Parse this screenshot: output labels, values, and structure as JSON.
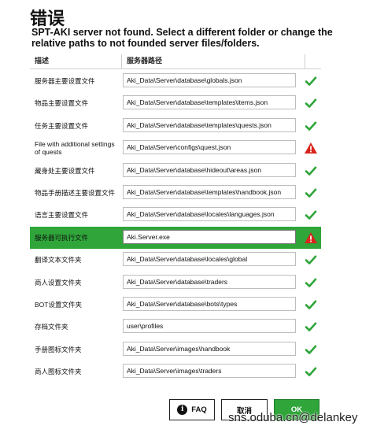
{
  "dialog": {
    "title": "错误",
    "message": "SPT-AKI server not found. Select a different folder or change the relative paths to not founded server files/folders."
  },
  "table": {
    "col_desc": "描述",
    "col_path": "服务器路径",
    "rows": [
      {
        "label": "服务器主要设置文件",
        "path": "Aki_Data\\Server\\database\\globals.json",
        "status": "ok"
      },
      {
        "label": "物品主要设置文件",
        "path": "Aki_Data\\Server\\database\\templates\\items.json",
        "status": "ok"
      },
      {
        "label": "任务主要设置文件",
        "path": "Aki_Data\\Server\\database\\templates\\quests.json",
        "status": "ok"
      },
      {
        "label": "File with additional settings of quests",
        "path": "Aki_Data\\Server\\configs\\quest.json",
        "status": "warning"
      },
      {
        "label": "藏身处主要设置文件",
        "path": "Aki_Data\\Server\\database\\hideout\\areas.json",
        "status": "ok"
      },
      {
        "label": "物品手册描述主要设置文件",
        "path": "Aki_Data\\Server\\database\\templates\\handbook.json",
        "status": "ok"
      },
      {
        "label": "语言主要设置文件",
        "path": "Aki_Data\\Server\\database\\locales\\languages.json",
        "status": "ok"
      },
      {
        "label": "服务器可执行文件",
        "path": "Aki.Server.exe",
        "status": "warning",
        "selected": true
      },
      {
        "label": "翻译文本文件夹",
        "path": "Aki_Data\\Server\\database\\locales\\global",
        "status": "ok"
      },
      {
        "label": "商人设置文件夹",
        "path": "Aki_Data\\Server\\database\\traders",
        "status": "ok"
      },
      {
        "label": "BOT设置文件夹",
        "path": "Aki_Data\\Server\\database\\bots\\types",
        "status": "ok"
      },
      {
        "label": "存档文件夹",
        "path": "user\\profiles",
        "status": "ok"
      },
      {
        "label": "手册图标文件夹",
        "path": "Aki_Data\\Server\\images\\handbook",
        "status": "ok"
      },
      {
        "label": "商人图标文件夹",
        "path": "Aki_Data\\Server\\images\\traders",
        "status": "ok"
      }
    ]
  },
  "buttons": {
    "faq": "FAQ",
    "cancel": "取消",
    "ok": "OK"
  },
  "watermark": "sns.oduba.cn@delankey",
  "colors": {
    "ok_green": "#2fa53a",
    "warning_red": "#d9241c",
    "selected_row": "#2fa53a"
  }
}
